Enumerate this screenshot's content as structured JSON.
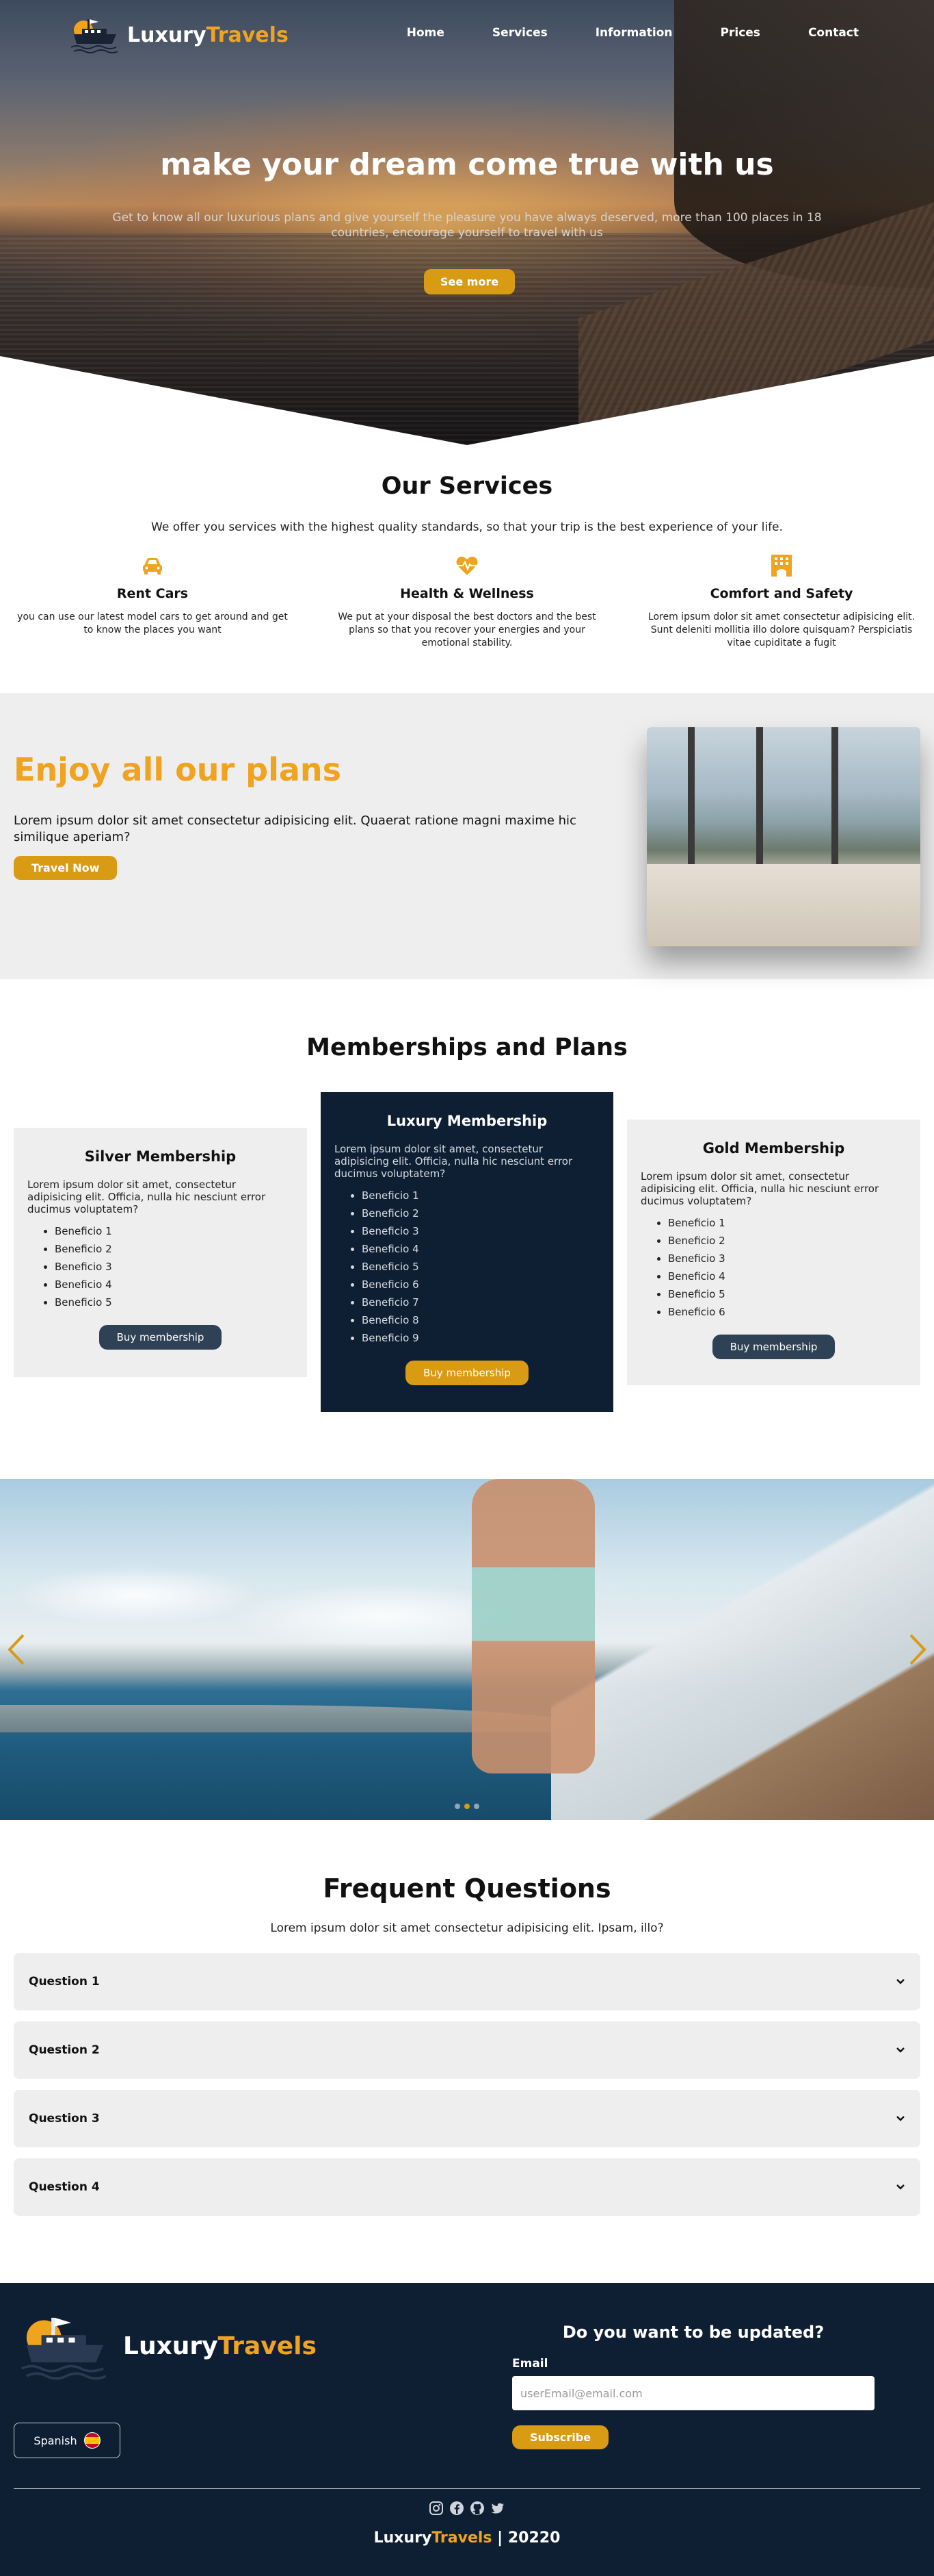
{
  "brand": {
    "name_part1": "Luxury",
    "name_part2": "Travels"
  },
  "nav": {
    "items": [
      "Home",
      "Services",
      "Information",
      "Prices",
      "Contact"
    ]
  },
  "hero": {
    "title": "make your dream come true with us",
    "subtitle": "Get to know all our luxurious plans and give yourself the pleasure you have always deserved, more than 100 places in 18 countries, encourage yourself to travel with us",
    "button": "See more"
  },
  "services": {
    "title": "Our Services",
    "subtitle": "We offer you services with the highest quality standards, so that your trip is the best experience of your life.",
    "items": [
      {
        "icon": "car-icon",
        "title": "Rent Cars",
        "text": "you can use our latest model cars to get around and get to know the places you want"
      },
      {
        "icon": "heart-pulse-icon",
        "title": "Health & Wellness",
        "text": "We put at your disposal the best doctors and the best plans so that you recover your energies and your emotional stability."
      },
      {
        "icon": "hotel-icon",
        "title": "Comfort and Safety",
        "text": "Lorem ipsum dolor sit amet consectetur adipisicing elit. Sunt deleniti mollitia illo dolore quisquam? Perspiciatis vitae cupiditate a fugit"
      }
    ]
  },
  "promo": {
    "title": "Enjoy all our plans",
    "text": "Lorem ipsum dolor sit amet consectetur adipisicing elit. Quaerat ratione magni maxime hic similique aperiam?",
    "button": "Travel Now"
  },
  "memberships": {
    "title": "Memberships and Plans",
    "plans": [
      {
        "name": "Silver Membership",
        "text": "Lorem ipsum dolor sit amet, consectetur adipisicing elit. Officia, nulla hic nesciunt error ducimus voluptatem?",
        "benefits": [
          "Beneficio 1",
          "Beneficio 2",
          "Beneficio 3",
          "Beneficio 4",
          "Beneficio 5"
        ],
        "button": "Buy membership"
      },
      {
        "name": "Luxury Membership",
        "text": "Lorem ipsum dolor sit amet, consectetur adipisicing elit. Officia, nulla hic nesciunt error ducimus voluptatem?",
        "benefits": [
          "Beneficio 1",
          "Beneficio 2",
          "Beneficio 3",
          "Beneficio 4",
          "Beneficio 5",
          "Beneficio 6",
          "Beneficio 7",
          "Beneficio 8",
          "Beneficio 9"
        ],
        "button": "Buy membership"
      },
      {
        "name": "Gold Membership",
        "text": "Lorem ipsum dolor sit amet, consectetur adipisicing elit. Officia, nulla hic nesciunt error ducimus voluptatem?",
        "benefits": [
          "Beneficio 1",
          "Beneficio 2",
          "Beneficio 3",
          "Beneficio 4",
          "Beneficio 5",
          "Beneficio 6"
        ],
        "button": "Buy membership"
      }
    ]
  },
  "carousel": {
    "slide_count": 3,
    "active_slide": 1
  },
  "faq": {
    "title": "Frequent Questions",
    "subtitle": "Lorem ipsum dolor sit amet consectetur adipisicing elit. Ipsam, illo?",
    "questions": [
      "Question 1",
      "Question 2",
      "Question 3",
      "Question 4"
    ]
  },
  "footer": {
    "language": "Spanish",
    "newsletter_title": "Do you want to be updated?",
    "email_label": "Email",
    "email_placeholder": "userEmail@email.com",
    "subscribe": "Subscribe",
    "social_icons": [
      "instagram-icon",
      "facebook-icon",
      "github-icon",
      "twitter-icon"
    ],
    "copyright_year": "| 20220"
  },
  "colors": {
    "accent": "#f0a31f",
    "button_gold": "#d99a14",
    "navy": "#0f1f33",
    "button_navy": "#2f4155",
    "panel": "#eeeeee"
  }
}
